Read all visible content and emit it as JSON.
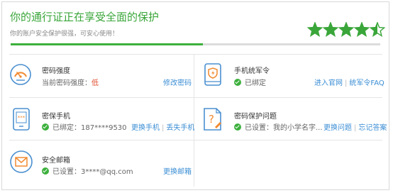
{
  "header": {
    "title": "你的通行证正在享受全面的保护",
    "subtitle": "你的账户安全保护很强，可安心使用！",
    "progress": 0.52,
    "rating": 4.5,
    "rating_max": 5,
    "accent": "#3aa63a"
  },
  "items": {
    "password": {
      "icon": "speedometer-icon",
      "title": "密码强度",
      "status_prefix": "当前密码强度：",
      "status_value": "低",
      "links": [
        "修改密码"
      ]
    },
    "token": {
      "icon": "phone-shield-icon",
      "title": "手机统军令",
      "status": "已绑定",
      "links": [
        "进入官网",
        "统军令FAQ"
      ]
    },
    "phone": {
      "icon": "mobile-password-icon",
      "title": "密保手机",
      "status": "已绑定：187****9530",
      "links": [
        "更换手机",
        "丢失手机"
      ]
    },
    "question": {
      "icon": "question-document-icon",
      "title": "密码保护问题",
      "status": "已设置：我的小学名字...",
      "links": [
        "更换问题",
        "忘记答案"
      ]
    },
    "email": {
      "icon": "envelope-icon",
      "title": "安全邮箱",
      "status": "已设置：3****@qq.com",
      "links": [
        "更换邮箱"
      ]
    }
  }
}
